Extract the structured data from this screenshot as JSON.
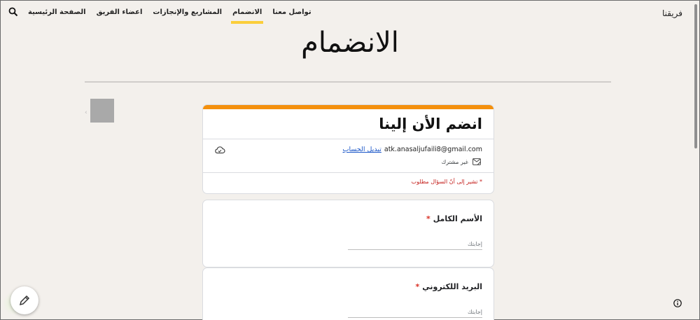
{
  "site": {
    "brand": "فريقنا"
  },
  "nav": {
    "items": [
      {
        "label": "الصفحة الرئيسية",
        "active": false
      },
      {
        "label": "اعضاء الفريق",
        "active": false
      },
      {
        "label": "المشاريع والإنجازات",
        "active": false
      },
      {
        "label": "الانضمام",
        "active": true
      },
      {
        "label": "تواصل معنا",
        "active": false
      }
    ],
    "search_icon": "search-icon"
  },
  "page": {
    "title": "الانضمام"
  },
  "form": {
    "title": "انضم الأن إلينا",
    "account_email": "atk.anasaljufaili8@gmail.com",
    "switch_account": "تبديل الحساب",
    "not_shared": "غير مشترك",
    "required_note": "* تشير إلى أنّ السؤال مطلوب",
    "accent_color": "#f4900c",
    "questions": [
      {
        "label": "الأسم الكامل",
        "required": "*",
        "placeholder": "إجابتك"
      },
      {
        "label": "البريد اللكتروني",
        "required": "*",
        "placeholder": "إجابتك"
      }
    ]
  },
  "colors": {
    "nav_active": "#fbce3a",
    "required": "#d93025",
    "link": "#1a56c8"
  }
}
